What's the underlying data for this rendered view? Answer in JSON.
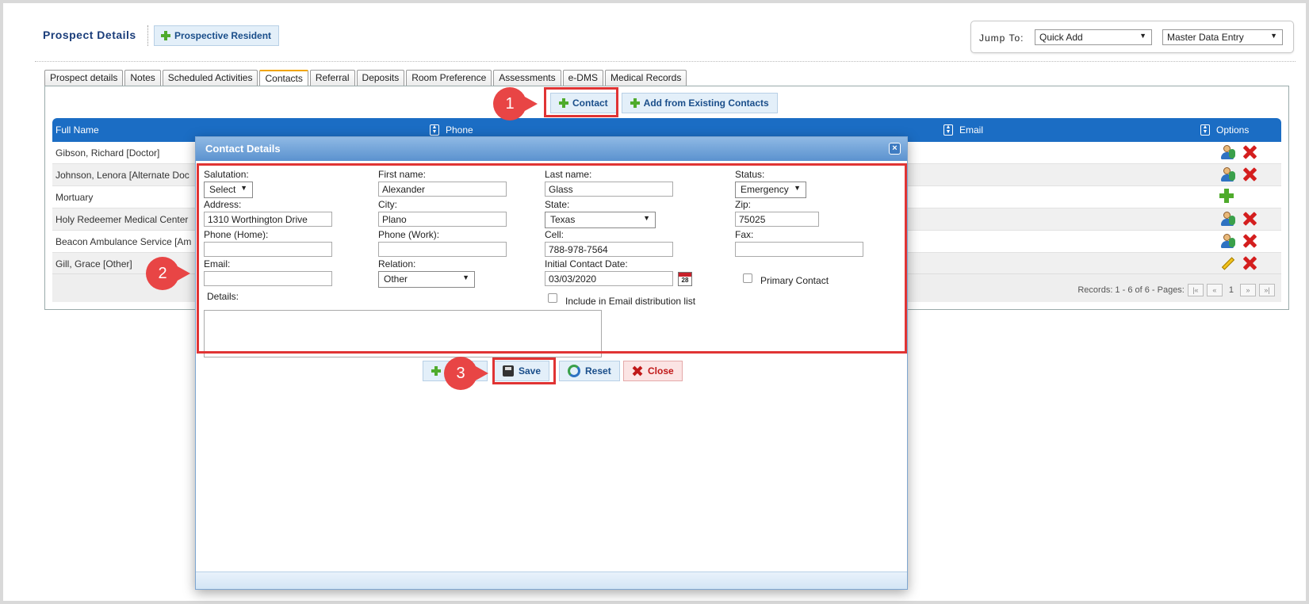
{
  "header": {
    "title": "Prospect Details",
    "prospective_resident_button": "Prospective Resident",
    "jump_to_label": "Jump To:",
    "jump_select_1": "Quick Add",
    "jump_select_2": "Master Data Entry"
  },
  "tabs": [
    {
      "label": "Prospect details"
    },
    {
      "label": "Notes"
    },
    {
      "label": "Scheduled Activities"
    },
    {
      "label": "Contacts"
    },
    {
      "label": "Referral"
    },
    {
      "label": "Deposits"
    },
    {
      "label": "Room Preference"
    },
    {
      "label": "Assessments"
    },
    {
      "label": "e-DMS"
    },
    {
      "label": "Medical Records"
    }
  ],
  "toolbar": {
    "contact_button": "Contact",
    "add_existing_button": "Add from Existing Contacts"
  },
  "grid": {
    "columns": {
      "full_name": "Full Name",
      "phone": "Phone",
      "email": "Email",
      "options": "Options"
    },
    "rows": [
      {
        "name": "Gibson, Richard [Doctor]"
      },
      {
        "name": "Johnson, Lenora [Alternate Doc"
      },
      {
        "name": "Mortuary"
      },
      {
        "name": "Holy Redeemer Medical Center"
      },
      {
        "name": "Beacon Ambulance Service [Am"
      },
      {
        "name": "Gill, Grace [Other]"
      }
    ],
    "records_text": "Records: 1 - 6 of 6 - Pages:",
    "page_number": "1"
  },
  "dialog": {
    "title": "Contact Details",
    "close_glyph": "×",
    "labels": {
      "salutation": "Salutation:",
      "first_name": "First name:",
      "last_name": "Last name:",
      "status": "Status:",
      "address": "Address:",
      "city": "City:",
      "state": "State:",
      "zip": "Zip:",
      "phone_home": "Phone (Home):",
      "phone_work": "Phone (Work):",
      "cell": "Cell:",
      "fax": "Fax:",
      "email": "Email:",
      "relation": "Relation:",
      "initial_contact_date": "Initial Contact Date:",
      "primary_contact": "Primary Contact",
      "include_email": "Include in Email distribution list",
      "details": "Details:"
    },
    "values": {
      "salutation": "Select",
      "first_name": "Alexander",
      "last_name": "Glass",
      "status": "Emergency",
      "address": "1310 Worthington Drive",
      "city": "Plano",
      "state": "Texas",
      "zip": "75025",
      "phone_home": "",
      "phone_work": "",
      "cell": "788-978-7564",
      "fax": "",
      "email": "",
      "relation": "Other",
      "initial_contact_date": "03/03/2020",
      "calendar_day": "28"
    },
    "buttons": {
      "save": "Save",
      "reset": "Reset",
      "close": "Close"
    }
  },
  "callouts": {
    "one": "1",
    "two": "2",
    "three": "3"
  },
  "colors": {
    "grid_header": "#1b6dc4",
    "callout": "#e84545",
    "highlight": "#e03434"
  }
}
